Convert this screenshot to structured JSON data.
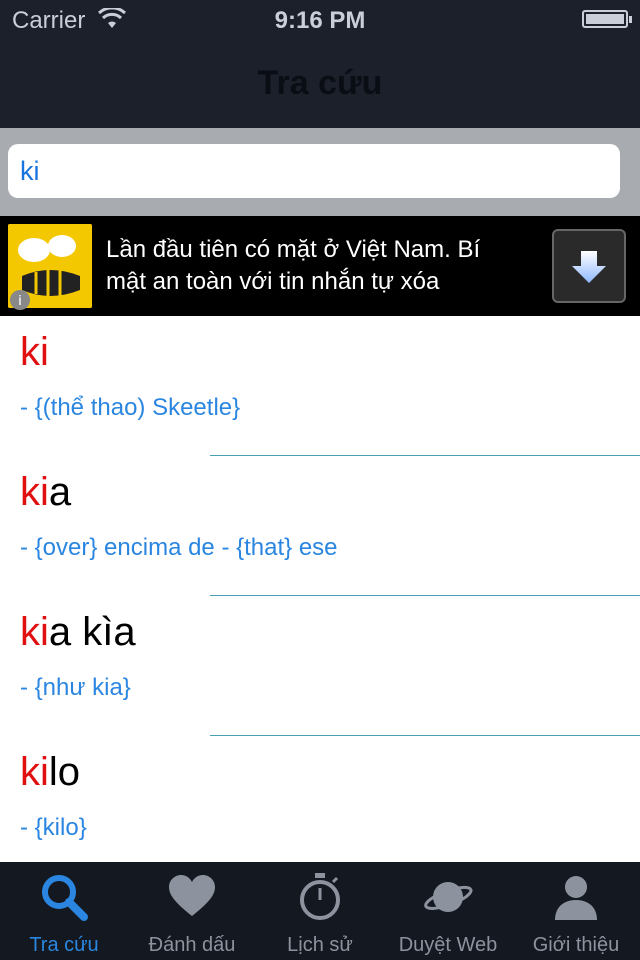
{
  "status_bar": {
    "carrier": "Carrier",
    "time": "9:16 PM"
  },
  "nav": {
    "title": "Tra cứu"
  },
  "search": {
    "value": "ki"
  },
  "ad": {
    "text": "Lần đầu tiên có mặt ở Việt Nam. Bí mật an toàn với tin nhắn tự xóa",
    "info_glyph": "i"
  },
  "results": [
    {
      "match": "ki",
      "rest": "",
      "definition": "- {(thể thao) Skeetle}"
    },
    {
      "match": "ki",
      "rest": "a",
      "definition": "- {over} encima de - {that} ese"
    },
    {
      "match": "ki",
      "rest": "a kìa",
      "definition": "- {như kia}"
    },
    {
      "match": "ki",
      "rest": "lo",
      "definition": "- {kilo}"
    }
  ],
  "tabs": [
    {
      "label": "Tra cứu",
      "icon": "search-icon",
      "active": true
    },
    {
      "label": "Đánh dấu",
      "icon": "heart-icon",
      "active": false
    },
    {
      "label": "Lịch sử",
      "icon": "stopwatch-icon",
      "active": false
    },
    {
      "label": "Duyệt Web",
      "icon": "planet-icon",
      "active": false
    },
    {
      "label": "Giới thiệu",
      "icon": "person-icon",
      "active": false
    }
  ],
  "colors": {
    "accent": "#2a86e0",
    "highlight": "#e01010",
    "topbar": "#1b202b",
    "tabbar": "#141820"
  }
}
